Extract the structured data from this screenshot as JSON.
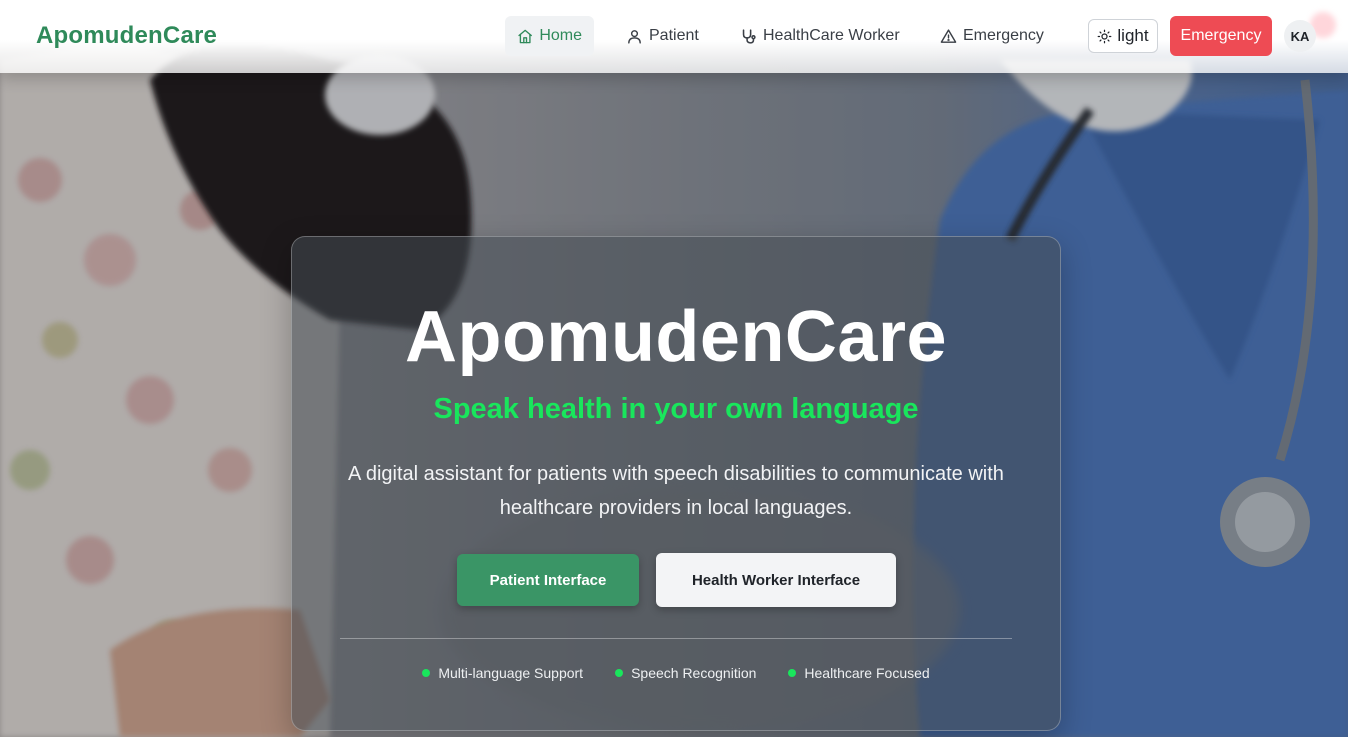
{
  "brand": {
    "name": "ApomudenCare",
    "color": "#2f8a5a"
  },
  "nav": {
    "items": [
      {
        "label": "Home",
        "icon": "home-icon",
        "active": true
      },
      {
        "label": "Patient",
        "icon": "user-icon",
        "active": false
      },
      {
        "label": "HealthCare Worker",
        "icon": "stethoscope-icon",
        "active": false
      },
      {
        "label": "Emergency",
        "icon": "warning-triangle-icon",
        "active": false
      }
    ],
    "theme_toggle": {
      "label": "light",
      "icon": "sun-icon"
    },
    "emergency_button": {
      "label": "Emergency",
      "color": "#ee4b54"
    },
    "avatar": {
      "initials": "KA"
    }
  },
  "hero": {
    "title": "ApomudenCare",
    "tagline": "Speak health in your own language",
    "tagline_color": "#19e65c",
    "description": "A digital assistant for patients with speech disabilities to communicate with healthcare providers in local languages.",
    "primary_button": {
      "label": "Patient Interface",
      "color": "#3a9566"
    },
    "secondary_button": {
      "label": "Health Worker Interface"
    },
    "features": [
      {
        "label": "Multi-language Support"
      },
      {
        "label": "Speech Recognition"
      },
      {
        "label": "Healthcare Focused"
      }
    ]
  }
}
